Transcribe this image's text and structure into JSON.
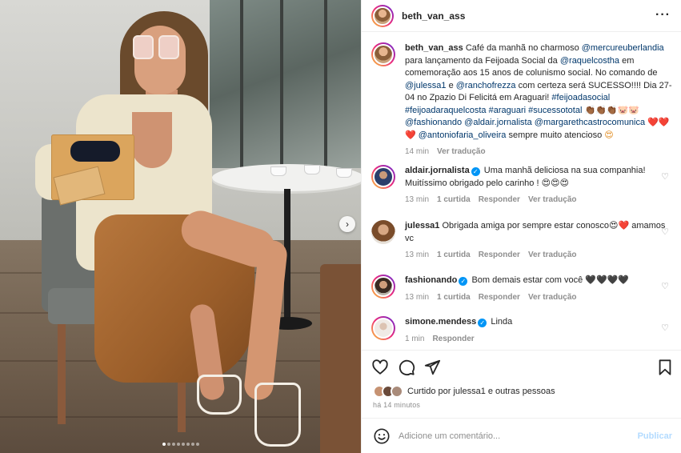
{
  "post": {
    "author": "beth_van_ass",
    "more_icon": "more-horizontal-icon",
    "carousel_dots": 8,
    "carousel_active": 0
  },
  "caption": {
    "user": "beth_van_ass",
    "t1": " Café da manhã no charmoso ",
    "m1": "@mercureuberlandia",
    "t2": " para lançamento da Feijoada Social da ",
    "m2": "@raquelcostha",
    "t3": " em comemoração aos 15 anos de colunismo social. No comando de ",
    "m3": "@julessa1",
    "t4": " e ",
    "m4": "@ranchofrezza",
    "t5": " com certeza será SUCESSO!!!! Dia 27-04 no Zpazio Di Felicitá em Araguari! ",
    "h1": "#feijoadasocial",
    "h2": "#feijoadaraquelcosta",
    "h3": "#araguari",
    "h4": "#sucessototal",
    "e1": "👏🏾👏🏾👏🏾🐷🐷",
    "m5": "@fashionando",
    "m6": "@aldair.jornalista",
    "m7": "@margarethcastrocomunica",
    "e2": "❤️❤️❤️",
    "m8": "@antoniofaria_oliveira",
    "t6": " sempre muito atencioso ",
    "e3": "😍",
    "time": "14 min",
    "see_translation": "Ver tradução"
  },
  "comments": [
    {
      "user": "aldair.jornalista",
      "verified": true,
      "text": "Uma manhã deliciosa na sua companhia! Muitíssimo obrigado pelo carinho ! 😍😍😍",
      "time": "13 min",
      "likes": "1 curtida",
      "reply": "Responder",
      "translate": "Ver tradução"
    },
    {
      "user": "julessa1",
      "verified": false,
      "text": "Obrigada amiga por sempre estar conosco😍❤️ amamos vc",
      "time": "13 min",
      "likes": "1 curtida",
      "reply": "Responder",
      "translate": "Ver tradução"
    },
    {
      "user": "fashionando",
      "verified": true,
      "text": "Bom demais estar com você 🖤🖤🖤🖤",
      "time": "13 min",
      "likes": "1 curtida",
      "reply": "Responder",
      "translate": "Ver tradução"
    },
    {
      "user": "simone.mendess",
      "verified": true,
      "text": "Linda",
      "time": "1 min",
      "reply": "Responder"
    }
  ],
  "liked_by": "Curtido por julessa1 e outras pessoas",
  "posted_ago": "há 14 minutos",
  "comment_input": {
    "placeholder": "Adicione um comentário...",
    "publish": "Publicar"
  },
  "icons": {
    "like": "heart-icon",
    "comment": "comment-icon",
    "share": "send-icon",
    "save": "bookmark-icon",
    "emoji": "smiley-icon",
    "comment_like": "heart-outline-icon",
    "next": "chevron-right-icon"
  },
  "colors": {
    "link": "#00376b",
    "verified": "#0095f6",
    "muted": "#8e8e8e",
    "publish_disabled": "#b3dbff"
  }
}
